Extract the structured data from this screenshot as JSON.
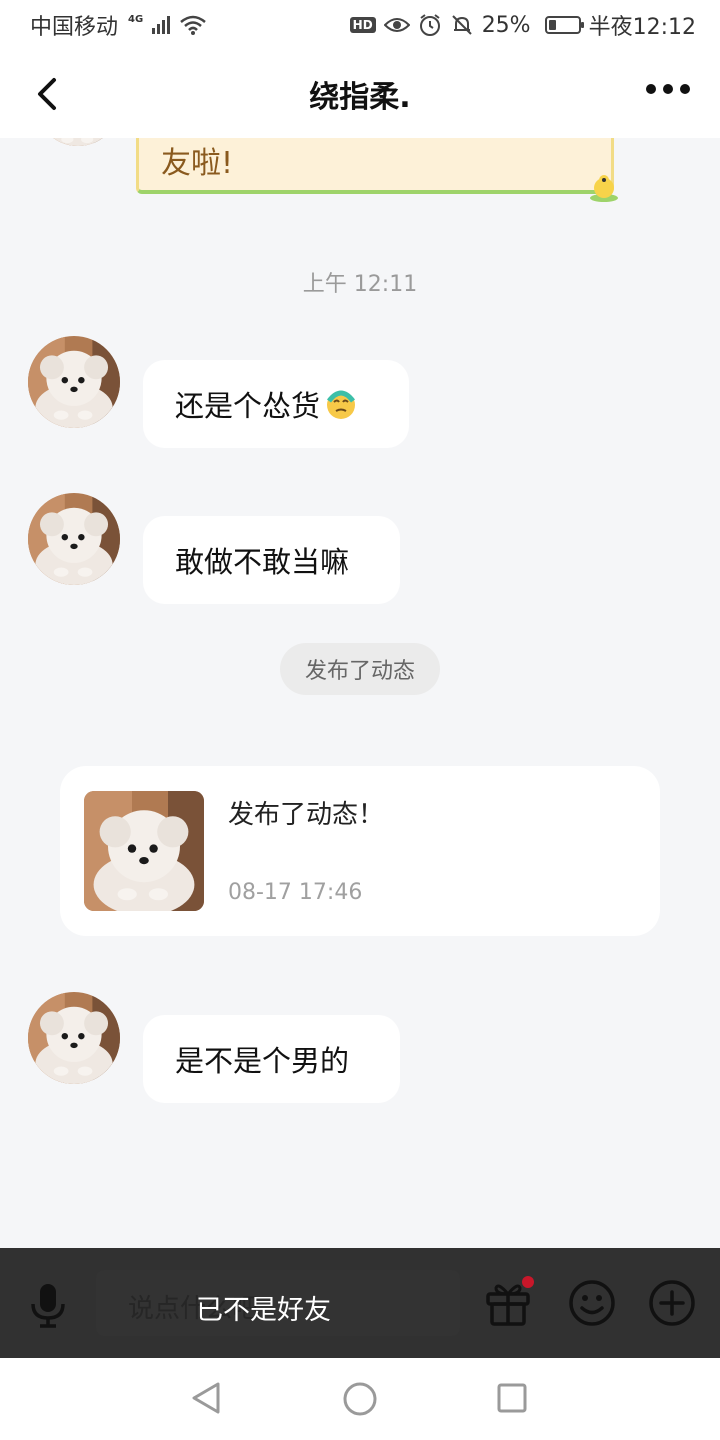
{
  "status_bar": {
    "carrier": "中国移动",
    "network": "4G",
    "hd": "HD",
    "battery": "25%",
    "battery_level": 0.25,
    "time": "半夜12:12"
  },
  "header": {
    "title": "绕指柔."
  },
  "messages": {
    "card_tail_text": "友啦!",
    "time_divider": "上午 12:11",
    "msg1": "还是个怂货",
    "msg2": "敢做不敢当嘛",
    "system_notice": "发布了动态",
    "moment": {
      "title": "发布了动态！",
      "date": "08-17 17:46"
    },
    "msg3": "是不是个男的"
  },
  "input_bar": {
    "placeholder": "说点什么吧",
    "status_text": "已不是好友"
  },
  "icons": {
    "back": "back-arrow-icon",
    "more": "more-icon",
    "mic": "microphone-icon",
    "gift": "gift-icon",
    "emoji": "smile-icon",
    "plus": "plus-icon"
  },
  "colors": {
    "chat_bg": "#f5f6f8",
    "input_bar_bg": "#313131",
    "card_bg": "#fdf1d8",
    "card_text": "#8a5a1e",
    "gift_dot": "#c8172a"
  }
}
